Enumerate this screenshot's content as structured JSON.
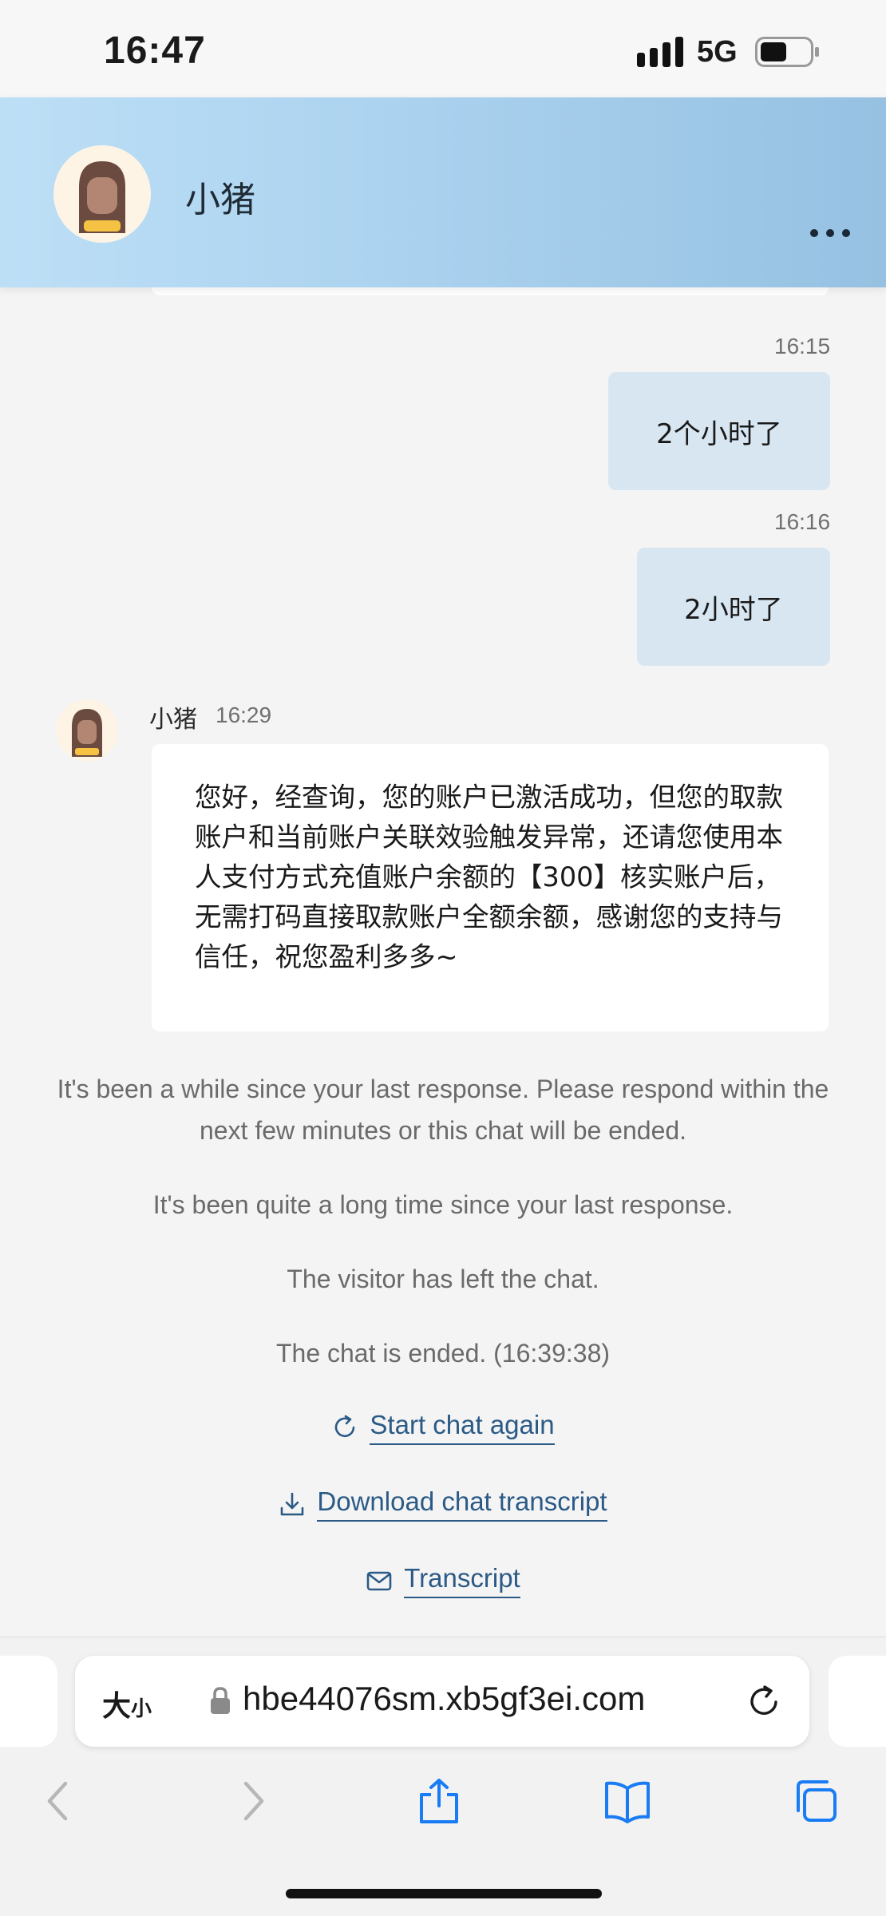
{
  "status_bar": {
    "time": "16:47",
    "network": "5G",
    "icons": [
      "signal-icon",
      "battery-icon"
    ]
  },
  "header": {
    "agent_name": "小猪",
    "menu_icon": "more-dots-icon"
  },
  "messages": [
    {
      "type": "outgoing",
      "time": "16:15",
      "text": "2个小时了"
    },
    {
      "type": "outgoing",
      "time": "16:16",
      "text": "2小时了"
    },
    {
      "type": "incoming",
      "sender": "小猪",
      "time": "16:29",
      "text": "您好，经查询，您的账户已激活成功，但您的取款账户和当前账户关联效验触发异常，还请您使用本人支付方式充值账户余额的【300】核实账户后，无需打码直接取款账户全额余额，感谢您的支持与信任，祝您盈利多多~"
    }
  ],
  "system_messages": [
    "It's been a while since your last response. Please respond within the next few minutes or this chat will be ended.",
    "It's been quite a long time since your last response.",
    "The visitor has left the chat.",
    "The chat is ended. (16:39:38)"
  ],
  "actions": {
    "start_again": "Start chat again",
    "download": "Download chat transcript",
    "transcript": "Transcript"
  },
  "browser": {
    "text_size": "大",
    "text_size_small": "小",
    "url": "hbe44076sm.xb5gf3ei.com"
  },
  "colors": {
    "header_gradient_start": "#bddff6",
    "header_gradient_end": "#96c1e2",
    "outgoing_bubble": "#d8e6f2",
    "link": "#2b5a86",
    "ios_blue": "#1a7cf5"
  }
}
